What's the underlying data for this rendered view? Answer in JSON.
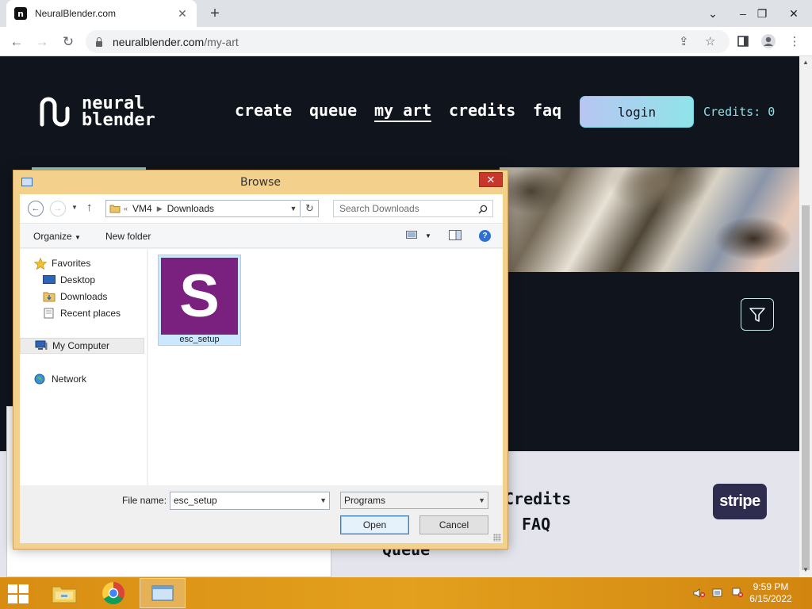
{
  "browser": {
    "tab_title": "NeuralBlender.com",
    "url_host": "neuralblender.com",
    "url_path": "/my-art"
  },
  "site": {
    "logo_line1": "neural",
    "logo_line2": "blender",
    "nav": [
      "create",
      "queue",
      "my art",
      "credits",
      "faq"
    ],
    "active_nav": "my art",
    "login_label": "login",
    "credits_label": "Credits: 0",
    "footer_links": [
      "Credits",
      "FAQ",
      "Queue"
    ],
    "stripe_label": "stripe"
  },
  "dialog": {
    "title": "Browse",
    "path_prefix": "«",
    "path": [
      "VM4",
      "Downloads"
    ],
    "search_placeholder": "Search Downloads",
    "organize_label": "Organize",
    "new_folder_label": "New folder",
    "nav_tree": {
      "favorites": "Favorites",
      "desktop": "Desktop",
      "downloads": "Downloads",
      "recent": "Recent places",
      "computer": "My Computer",
      "network": "Network"
    },
    "file": {
      "name": "esc_setup",
      "icon_letter": "S"
    },
    "filename_label": "File name:",
    "filename_value": "esc_setup",
    "filetype_value": "Programs",
    "open_label": "Open",
    "cancel_label": "Cancel"
  },
  "taskbar": {
    "time": "9:59 PM",
    "date": "6/15/2022"
  },
  "colors": {
    "page_bg": "#10141c",
    "dialog_frame": "#f3d08b",
    "taskbar": "#e3a01e",
    "file_thumb": "#7a2180",
    "stripe": "#2f2d4f"
  }
}
